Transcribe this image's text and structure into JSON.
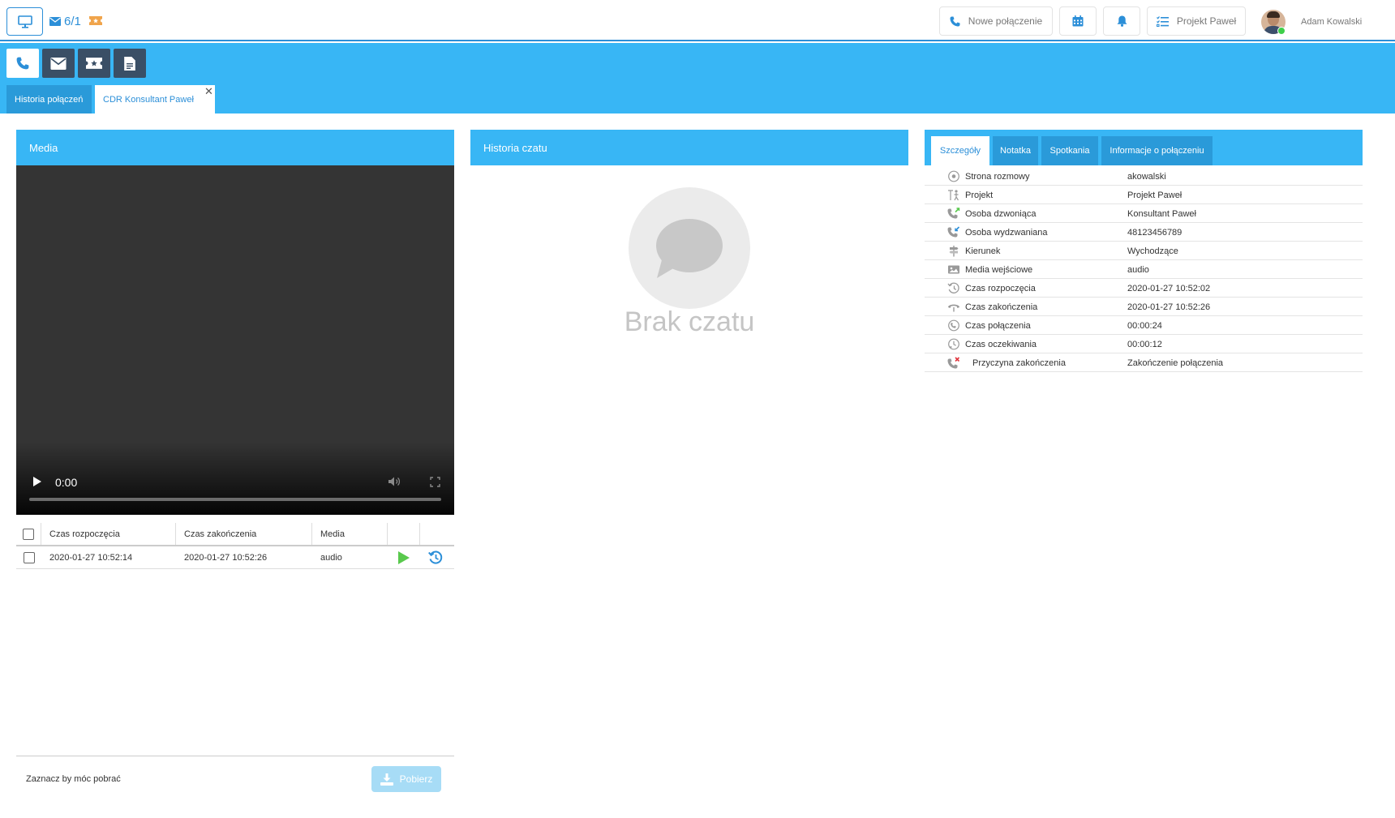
{
  "topbar": {
    "mail_count": "6/1",
    "new_call_label": "Nowe połączenie",
    "project_label": "Projekt Paweł",
    "user_name": "Adam Kowalski"
  },
  "tabs": [
    {
      "label": "Historia połączeń"
    },
    {
      "label": "CDR Konsultant Paweł"
    }
  ],
  "media": {
    "title": "Media",
    "player_time": "0:00",
    "columns": [
      "Czas rozpoczęcia",
      "Czas zakończenia",
      "Media"
    ],
    "rows": [
      {
        "start": "2020-01-27 10:52:14",
        "end": "2020-01-27 10:52:26",
        "media": "audio"
      }
    ],
    "footer_text": "Zaznacz by móc pobrać",
    "download_label": "Pobierz"
  },
  "chat": {
    "title": "Historia czatu",
    "empty_text": "Brak czatu"
  },
  "details": {
    "tabs": [
      "Szczegóły",
      "Notatka",
      "Spotkania",
      "Informacje o połączeniu"
    ],
    "rows": [
      {
        "label": "Strona rozmowy",
        "value": "akowalski",
        "icon": "record-icon"
      },
      {
        "label": "Projekt",
        "value": "Projekt Paweł",
        "icon": "project-icon"
      },
      {
        "label": "Osoba dzwoniąca",
        "value": "Konsultant Paweł",
        "icon": "caller-icon"
      },
      {
        "label": "Osoba wydzwaniana",
        "value": "48123456789",
        "icon": "callee-icon"
      },
      {
        "label": "Kierunek",
        "value": "Wychodzące",
        "icon": "direction-icon"
      },
      {
        "label": "Media wejściowe",
        "value": "audio",
        "icon": "media-icon"
      },
      {
        "label": "Czas rozpoczęcia",
        "value": "2020-01-27 10:52:02",
        "icon": "start-time-icon"
      },
      {
        "label": "Czas zakończenia",
        "value": "2020-01-27 10:52:26",
        "icon": "end-time-icon"
      },
      {
        "label": "Czas połączenia",
        "value": "00:00:24",
        "icon": "call-duration-icon"
      },
      {
        "label": "Czas oczekiwania",
        "value": "00:00:12",
        "icon": "wait-time-icon"
      },
      {
        "label": "Przyczyna zakończenia",
        "value": "Zakończenie połączenia",
        "icon": "hangup-reason-icon"
      }
    ]
  }
}
